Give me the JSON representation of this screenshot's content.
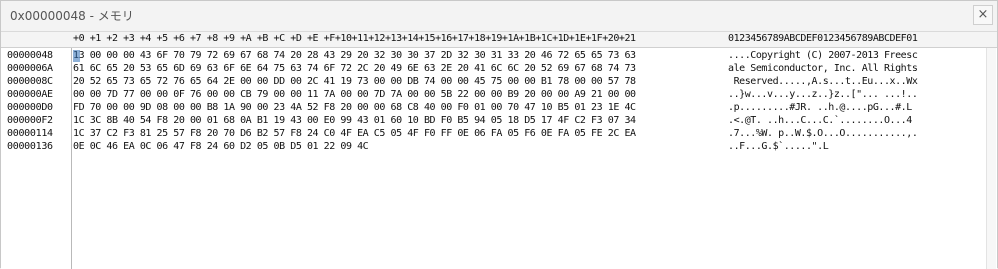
{
  "window": {
    "title": "0x00000048 - メモリ",
    "close_icon": "close-icon"
  },
  "header": {
    "hex_columns": "+0 +1 +2 +3 +4 +5 +6 +7 +8 +9 +A +B +C +D +E +F+10+11+12+13+14+15+16+17+18+19+1A+1B+1C+1D+1E+1F+20+21",
    "ascii_columns": "0123456789ABCDEF0123456789ABCDEF01"
  },
  "rows": [
    {
      "offset": "00000048",
      "hex": "13 00 00 00 43 6F 70 79 72 69 67 68 74 20 28 43 29 20 32 30 30 37 2D 32 30 31 33 20 46 72 65 65 73 63",
      "ascii": "....Copyright (C) 2007-2013 Freesc"
    },
    {
      "offset": "0000006A",
      "hex": "61 6C 65 20 53 65 6D 69 63 6F 6E 64 75 63 74 6F 72 2C 20 49 6E 63 2E 20 41 6C 6C 20 52 69 67 68 74 73",
      "ascii": "ale Semiconductor, Inc. All Rights"
    },
    {
      "offset": "0000008C",
      "hex": "20 52 65 73 65 72 76 65 64 2E 00 00 DD 00 2C 41 19 73 00 00 DB 74 00 00 45 75 00 00 B1 78 00 00 57 78",
      "ascii": " Reserved.....,A.s...t..Eu...x..Wx"
    },
    {
      "offset": "000000AE",
      "hex": "00 00 7D 77 00 00 0F 76 00 00 CB 79 00 00 11 7A 00 00 7D 7A 00 00 5B 22 00 00 B9 20 00 00 A9 21 00 00",
      "ascii": "..}w...v...y...z..}z..[\"... ...!.."
    },
    {
      "offset": "000000D0",
      "hex": "FD 70 00 00 9D 08 00 00 B8 1A 90 00 23 4A 52 F8 20 00 00 68 C8 40 00 F0 01 00 70 47 10 B5 01 23 1E 4C",
      "ascii": ".p.........#JR. ..h.@....pG...#.L"
    },
    {
      "offset": "000000F2",
      "hex": "1C 3C 8B 40 54 F8 20 00 01 68 0A B1 19 43 00 E0 99 43 01 60 10 BD F0 B5 94 05 18 D5 17 4F C2 F3 07 34",
      "ascii": ".<.@T. ..h...C...C.`........O...4"
    },
    {
      "offset": "00000114",
      "hex": "1C 37 C2 F3 81 25 57 F8 20 70 D6 B2 57 F8 24 C0 4F EA C5 05 4F F0 FF 0E 06 FA 05 F6 0E FA 05 FE 2C EA",
      "ascii": ".7...%W. p..W.$.O...O...........,."
    },
    {
      "offset": "00000136",
      "hex": "0E 0C 46 EA 0C 06 47 F8 24 60 D2 05 0B D5 01 22 09 4C",
      "ascii": "..F...G.$`.....\".L"
    }
  ]
}
